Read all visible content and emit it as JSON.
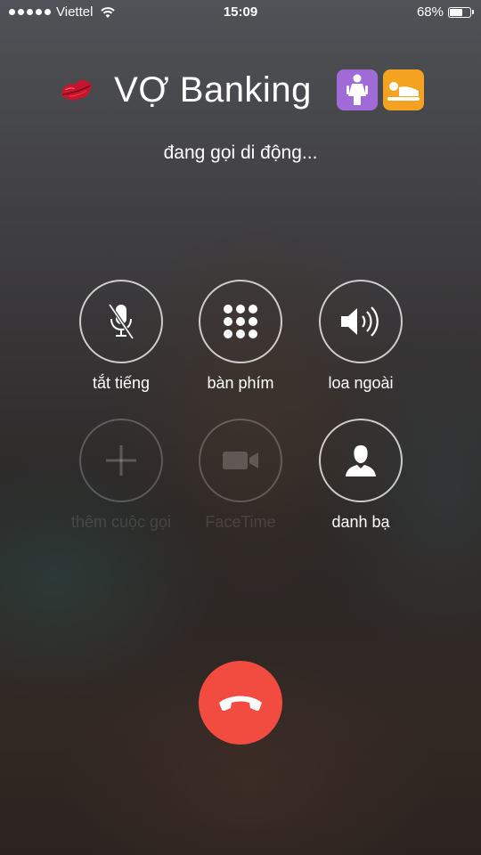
{
  "status_bar": {
    "carrier": "Viettel",
    "time": "15:09",
    "battery_percent": "68%",
    "battery_level": 0.68,
    "signal_bars": 5,
    "signal_icon": "signal-dots-icon",
    "wifi_icon": "wifi-icon",
    "battery_icon": "battery-icon"
  },
  "caller": {
    "name": "VỢ Banking",
    "status": "đang gọi di động...",
    "left_emoji": "kiss-mark-emoji",
    "right_emojis": [
      "womens-room-emoji",
      "person-in-bed-emoji"
    ]
  },
  "controls": {
    "mute": {
      "label": "tắt tiếng",
      "icon": "mic-off-icon"
    },
    "keypad": {
      "label": "bàn phím",
      "icon": "keypad-icon"
    },
    "speaker": {
      "label": "loa ngoài",
      "icon": "speaker-icon"
    },
    "add_call": {
      "label": "thêm cuộc gọi",
      "icon": "plus-icon",
      "enabled": false
    },
    "facetime": {
      "label": "FaceTime",
      "icon": "video-camera-icon",
      "enabled": false
    },
    "contacts": {
      "label": "danh bạ",
      "icon": "contact-icon"
    }
  },
  "end_call": {
    "icon": "phone-hang-up-icon",
    "color": "#f24b3f"
  }
}
